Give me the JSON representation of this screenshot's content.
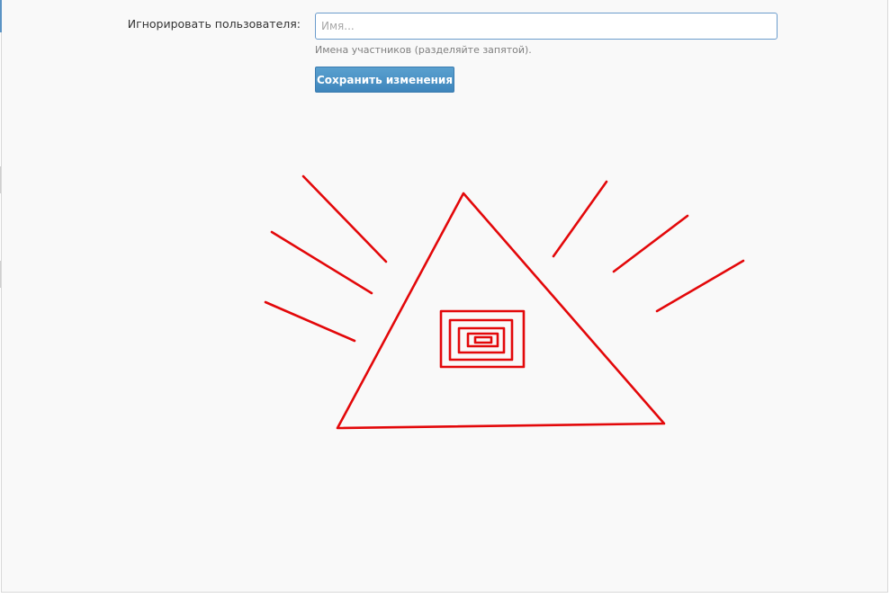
{
  "form": {
    "ignore_label": "Игнорировать пользователя:",
    "name_placeholder": "Имя...",
    "name_value": "",
    "hint": "Имена участников (разделяйте запятой).",
    "save_label": "Сохранить изменения"
  },
  "colors": {
    "accent": "#5b94c5",
    "button": "#4a90c4",
    "drawing": "#e3080a"
  },
  "drawing": {
    "subject": "eye-of-providence-doodle"
  }
}
